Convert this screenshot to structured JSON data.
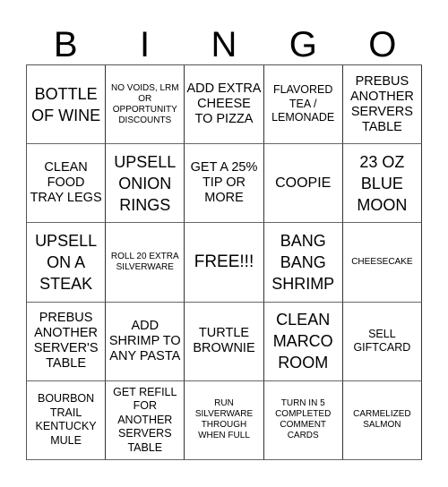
{
  "header": {
    "letters": [
      "B",
      "I",
      "N",
      "G",
      "O"
    ]
  },
  "cells": [
    [
      "BOTTLE OF WINE",
      "NO VOIDS, LRM OR OPPORTUNITY DISCOUNTS",
      "ADD EXTRA CHEESE TO PIZZA",
      "FLAVORED TEA / LEMONADE",
      "PREBUS ANOTHER SERVERS TABLE"
    ],
    [
      "CLEAN FOOD TRAY LEGS",
      "UPSELL ONION RINGS",
      "GET A 25% TIP OR MORE",
      "COOPIE",
      "23 OZ BLUE MOON"
    ],
    [
      "UPSELL ON A STEAK",
      "ROLL 20 EXTRA SILVERWARE",
      "FREE!!!",
      "BANG BANG SHRIMP",
      "CHEESECAKE"
    ],
    [
      "PREBUS ANOTHER SERVER'S TABLE",
      "ADD SHRIMP TO ANY PASTA",
      "TURTLE BROWNIE",
      "CLEAN MARCO ROOM",
      "SELL GIFTCARD"
    ],
    [
      "BOURBON TRAIL KENTUCKY MULE",
      "GET REFILL FOR ANOTHER SERVERS TABLE",
      "RUN SILVERWARE THROUGH WHEN FULL",
      "TURN IN 5 COMPLETED COMMENT CARDS",
      "CARMELIZED SALMON"
    ]
  ],
  "free_space": {
    "row": 2,
    "col": 2
  }
}
